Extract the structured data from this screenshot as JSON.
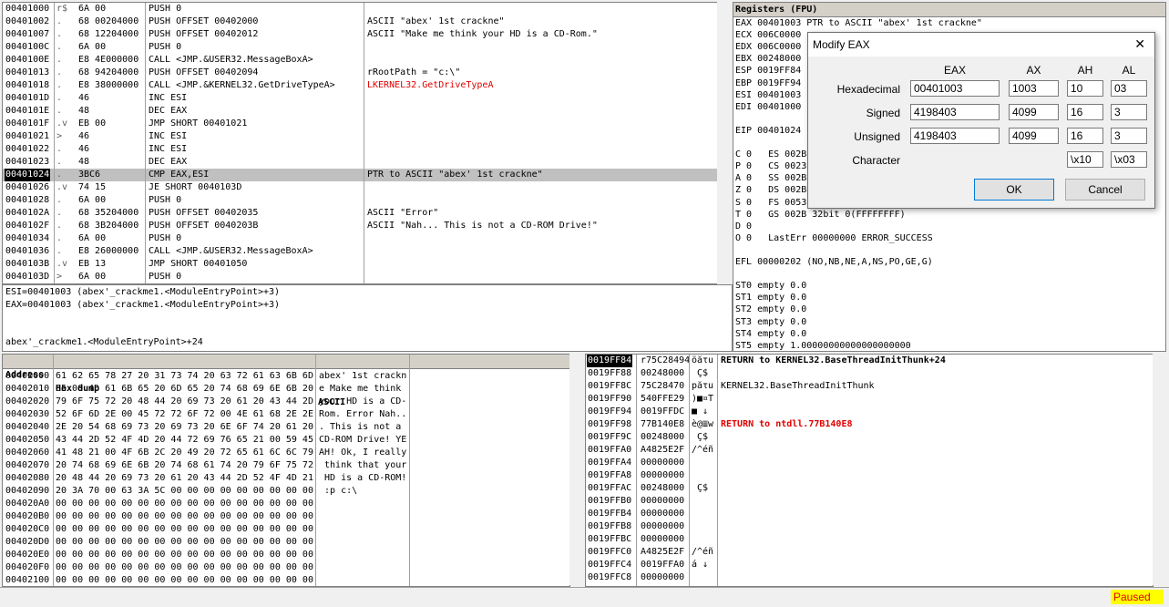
{
  "disasm": {
    "rows": [
      {
        "addr": "00401000",
        "m": "r$",
        "hex": "6A 00",
        "ins": "PUSH 0",
        "cmt": ""
      },
      {
        "addr": "00401002",
        "m": ".",
        "hex": "68 00204000",
        "ins": "PUSH OFFSET 00402000",
        "cmt": "ASCII \"abex' 1st crackne\""
      },
      {
        "addr": "00401007",
        "m": ".",
        "hex": "68 12204000",
        "ins": "PUSH OFFSET 00402012",
        "cmt": "ASCII \"Make me think your HD is a CD-Rom.\""
      },
      {
        "addr": "0040100C",
        "m": ".",
        "hex": "6A 00",
        "ins": "PUSH 0",
        "cmt": ""
      },
      {
        "addr": "0040100E",
        "m": ".",
        "hex": "E8 4E000000",
        "ins": "CALL <JMP.&USER32.MessageBoxA>",
        "cmt": ""
      },
      {
        "addr": "00401013",
        "m": ".",
        "hex": "68 94204000",
        "ins": "PUSH OFFSET 00402094",
        "cmt": "rRootPath = \"c:\\\""
      },
      {
        "addr": "00401018",
        "m": ".",
        "hex": "E8 38000000",
        "ins": "CALL <JMP.&KERNEL32.GetDriveTypeA>",
        "cmt": "LKERNEL32.GetDriveTypeA"
      },
      {
        "addr": "0040101D",
        "m": ".",
        "hex": "46",
        "ins": "INC ESI",
        "cmt": ""
      },
      {
        "addr": "0040101E",
        "m": ".",
        "hex": "48",
        "ins": "DEC EAX",
        "cmt": ""
      },
      {
        "addr": "0040101F",
        "m": ".v",
        "hex": "EB 00",
        "ins": "JMP SHORT 00401021",
        "cmt": ""
      },
      {
        "addr": "00401021",
        "m": ">",
        "hex": "46",
        "ins": "INC ESI",
        "cmt": ""
      },
      {
        "addr": "00401022",
        "m": ".",
        "hex": "46",
        "ins": "INC ESI",
        "cmt": ""
      },
      {
        "addr": "00401023",
        "m": ".",
        "hex": "48",
        "ins": "DEC EAX",
        "cmt": ""
      },
      {
        "addr": "00401024",
        "m": ".",
        "hex": "3BC6",
        "ins": "CMP EAX,ESI",
        "cmt": "PTR to ASCII \"abex' 1st crackne\""
      },
      {
        "addr": "00401026",
        "m": ".v",
        "hex": "74 15",
        "ins": "JE SHORT 0040103D",
        "cmt": ""
      },
      {
        "addr": "00401028",
        "m": ".",
        "hex": "6A 00",
        "ins": "PUSH 0",
        "cmt": ""
      },
      {
        "addr": "0040102A",
        "m": ".",
        "hex": "68 35204000",
        "ins": "PUSH OFFSET 00402035",
        "cmt": "ASCII \"Error\""
      },
      {
        "addr": "0040102F",
        "m": ".",
        "hex": "68 3B204000",
        "ins": "PUSH OFFSET 0040203B",
        "cmt": "ASCII \"Nah... This is not a CD-ROM Drive!\""
      },
      {
        "addr": "00401034",
        "m": ".",
        "hex": "6A 00",
        "ins": "PUSH 0",
        "cmt": ""
      },
      {
        "addr": "00401036",
        "m": ".",
        "hex": "E8 26000000",
        "ins": "CALL <JMP.&USER32.MessageBoxA>",
        "cmt": ""
      },
      {
        "addr": "0040103B",
        "m": ".v",
        "hex": "EB 13",
        "ins": "JMP SHORT 00401050",
        "cmt": ""
      },
      {
        "addr": "0040103D",
        "m": ">",
        "hex": "6A 00",
        "ins": "PUSH 0",
        "cmt": ""
      }
    ]
  },
  "info": {
    "line1": "ESI=00401003 (abex'_crackme1.<ModuleEntryPoint>+3)",
    "line2": "EAX=00401003 (abex'_crackme1.<ModuleEntryPoint>+3)",
    "line3": "abex'_crackme1.<ModuleEntryPoint>+24"
  },
  "registers": {
    "title": "Registers (FPU)",
    "rows": [
      {
        "t": "EAX 00401003 PTR to ASCII \"abex' 1st crackne\""
      },
      {
        "t": "ECX 006C0000"
      },
      {
        "t": "EDX 006C0000"
      },
      {
        "t": "EBX 00248000"
      },
      {
        "t": "ESP 0019FF84"
      },
      {
        "t": "EBP 0019FF94"
      },
      {
        "t": "ESI 00401003"
      },
      {
        "t": "EDI 00401000"
      },
      {
        "t": ""
      },
      {
        "t": "EIP 00401024"
      },
      {
        "t": ""
      },
      {
        "t": "C 0   ES 002B"
      },
      {
        "t": "P 0   CS 0023"
      },
      {
        "t": "A 0   SS 002B"
      },
      {
        "t": "Z 0   DS 002B"
      },
      {
        "t": "S 0   FS 0053"
      },
      {
        "t": "T 0   GS 002B 32bit 0(FFFFFFFF)"
      },
      {
        "t": "D 0"
      },
      {
        "t": "O 0   LastErr 00000000 ERROR_SUCCESS"
      },
      {
        "t": ""
      },
      {
        "t": "EFL 00000202 (NO,NB,NE,A,NS,PO,GE,G)"
      },
      {
        "t": ""
      },
      {
        "t": "ST0 empty 0.0"
      },
      {
        "t": "ST1 empty 0.0"
      },
      {
        "t": "ST2 empty 0.0"
      },
      {
        "t": "ST3 empty 0.0"
      },
      {
        "t": "ST4 empty 0.0"
      },
      {
        "t": "ST5 empty 1.00000000000000000000"
      }
    ]
  },
  "dump": {
    "headers": {
      "address": "Address",
      "hex": "Hex dump",
      "ascii": "ASCII"
    },
    "rows": [
      {
        "a": "00402000",
        "h": "61 62 65 78 27 20 31 73 74 20 63 72 61 63 6B 6D",
        "s": "abex' 1st crackn"
      },
      {
        "a": "00402010",
        "h": "65 00 4D 61 6B 65 20 6D 65 20 74 68 69 6E 6B 20",
        "s": "e Make me think "
      },
      {
        "a": "00402020",
        "h": "79 6F 75 72 20 48 44 20 69 73 20 61 20 43 44 2D",
        "s": "your HD is a CD-"
      },
      {
        "a": "00402030",
        "h": "52 6F 6D 2E 00 45 72 72 6F 72 00 4E 61 68 2E 2E",
        "s": "Rom. Error Nah.."
      },
      {
        "a": "00402040",
        "h": "2E 20 54 68 69 73 20 69 73 20 6E 6F 74 20 61 20",
        "s": ". This is not a "
      },
      {
        "a": "00402050",
        "h": "43 44 2D 52 4F 4D 20 44 72 69 76 65 21 00 59 45",
        "s": "CD-ROM Drive! YE"
      },
      {
        "a": "00402060",
        "h": "41 48 21 00 4F 6B 2C 20 49 20 72 65 61 6C 6C 79",
        "s": "AH! Ok, I really"
      },
      {
        "a": "00402070",
        "h": "20 74 68 69 6E 6B 20 74 68 61 74 20 79 6F 75 72",
        "s": " think that your"
      },
      {
        "a": "00402080",
        "h": "20 48 44 20 69 73 20 61 20 43 44 2D 52 4F 4D 21",
        "s": " HD is a CD-ROM!"
      },
      {
        "a": "00402090",
        "h": "20 3A 70 00 63 3A 5C 00 00 00 00 00 00 00 00 00",
        "s": " :p c:\\"
      },
      {
        "a": "004020A0",
        "h": "00 00 00 00 00 00 00 00 00 00 00 00 00 00 00 00",
        "s": ""
      },
      {
        "a": "004020B0",
        "h": "00 00 00 00 00 00 00 00 00 00 00 00 00 00 00 00",
        "s": ""
      },
      {
        "a": "004020C0",
        "h": "00 00 00 00 00 00 00 00 00 00 00 00 00 00 00 00",
        "s": ""
      },
      {
        "a": "004020D0",
        "h": "00 00 00 00 00 00 00 00 00 00 00 00 00 00 00 00",
        "s": ""
      },
      {
        "a": "004020E0",
        "h": "00 00 00 00 00 00 00 00 00 00 00 00 00 00 00 00",
        "s": ""
      },
      {
        "a": "004020F0",
        "h": "00 00 00 00 00 00 00 00 00 00 00 00 00 00 00 00",
        "s": ""
      },
      {
        "a": "00402100",
        "h": "00 00 00 00 00 00 00 00 00 00 00 00 00 00 00 00",
        "s": ""
      }
    ]
  },
  "stack": {
    "rows": [
      {
        "a": "0019FF84",
        "v": "r75C28494",
        "s": "öăτu",
        "c": "RETURN to KERNEL32.BaseThreadInitThunk+24"
      },
      {
        "a": "0019FF88",
        "v": "00248000",
        "s": " Ç$",
        "c": ""
      },
      {
        "a": "0019FF8C",
        "v": "75C28470",
        "s": "păτu",
        "c": "KERNEL32.BaseThreadInitThunk"
      },
      {
        "a": "0019FF90",
        "v": "540FFE29",
        "s": ")■¤T",
        "c": ""
      },
      {
        "a": "0019FF94",
        "v": "0019FFDC",
        "s": "■ ↓",
        "c": ""
      },
      {
        "a": "0019FF98",
        "v": "77B140E8",
        "s": "è@≣w",
        "c": "RETURN to ntdll.77B140E8"
      },
      {
        "a": "0019FF9C",
        "v": "00248000",
        "s": " Ç$",
        "c": ""
      },
      {
        "a": "0019FFA0",
        "v": "A4825E2F",
        "s": "/^éñ",
        "c": ""
      },
      {
        "a": "0019FFA4",
        "v": "00000000",
        "s": "",
        "c": ""
      },
      {
        "a": "0019FFA8",
        "v": "00000000",
        "s": "",
        "c": ""
      },
      {
        "a": "0019FFAC",
        "v": "00248000",
        "s": " Ç$",
        "c": ""
      },
      {
        "a": "0019FFB0",
        "v": "00000000",
        "s": "",
        "c": ""
      },
      {
        "a": "0019FFB4",
        "v": "00000000",
        "s": "",
        "c": ""
      },
      {
        "a": "0019FFB8",
        "v": "00000000",
        "s": "",
        "c": ""
      },
      {
        "a": "0019FFBC",
        "v": "00000000",
        "s": "",
        "c": ""
      },
      {
        "a": "0019FFC0",
        "v": "A4825E2F",
        "s": "/^éñ",
        "c": ""
      },
      {
        "a": "0019FFC4",
        "v": "0019FFA0",
        "s": "á ↓",
        "c": ""
      },
      {
        "a": "0019FFC8",
        "v": "00000000",
        "s": "",
        "c": ""
      }
    ]
  },
  "dialog": {
    "title": "Modify EAX",
    "close": "✕",
    "cols": {
      "eax": "EAX",
      "ax": "AX",
      "ah": "AH",
      "al": "AL"
    },
    "labels": {
      "hex": "Hexadecimal",
      "signed": "Signed",
      "unsigned": "Unsigned",
      "char": "Character"
    },
    "hex": {
      "eax": "00401003",
      "ax": "1003",
      "ah": "10",
      "al": "03"
    },
    "signed": {
      "eax": "4198403",
      "ax": "4099",
      "ah": "16",
      "al": "3"
    },
    "unsigned": {
      "eax": "4198403",
      "ax": "4099",
      "ah": "16",
      "al": "3"
    },
    "char": {
      "ah": "\\x10",
      "al": "\\x03"
    },
    "ok": "OK",
    "cancel": "Cancel"
  },
  "status": {
    "state": "Paused",
    "state_color": "#ffff00"
  }
}
